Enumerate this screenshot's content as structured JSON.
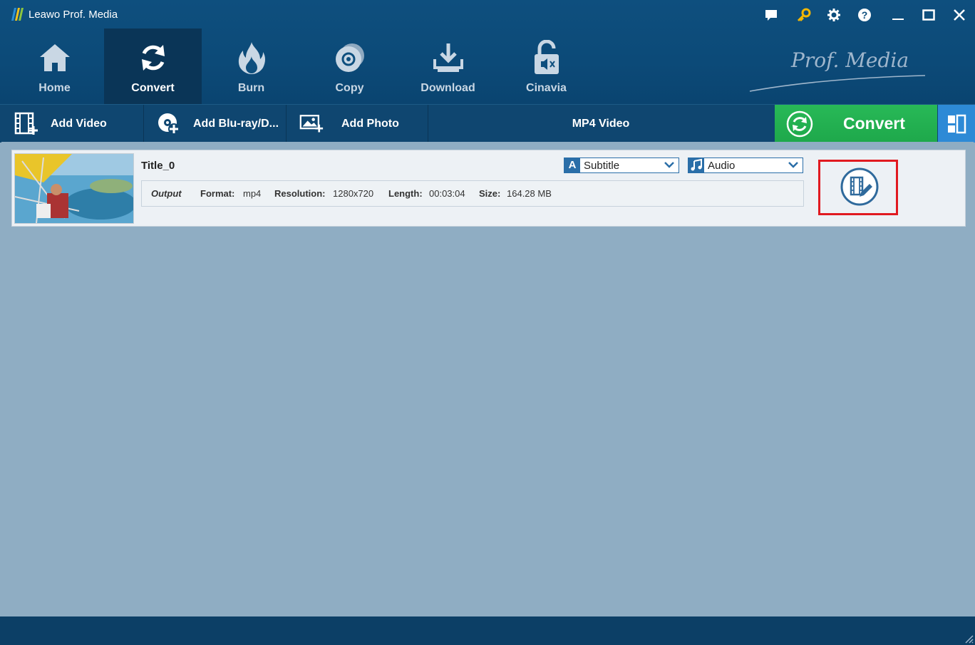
{
  "window": {
    "title": "Leawo Prof. Media"
  },
  "nav": {
    "items": [
      {
        "label": "Home",
        "icon": "home-icon"
      },
      {
        "label": "Convert",
        "icon": "convert-icon",
        "active": true
      },
      {
        "label": "Burn",
        "icon": "burn-icon"
      },
      {
        "label": "Copy",
        "icon": "copy-icon"
      },
      {
        "label": "Download",
        "icon": "download-icon"
      },
      {
        "label": "Cinavia",
        "icon": "cinavia-icon"
      }
    ]
  },
  "brand": {
    "text": "Prof. Media"
  },
  "toolbar": {
    "add_video": "Add Video",
    "add_bluray": "Add Blu-ray/D...",
    "add_photo": "Add Photo",
    "format": "MP4 Video",
    "convert": "Convert"
  },
  "file": {
    "title": "Title_0",
    "subtitle": "Subtitle",
    "audio": "Audio",
    "output_label": "Output",
    "format_key": "Format:",
    "format_val": "mp4",
    "resolution_key": "Resolution:",
    "resolution_val": "1280x720",
    "length_key": "Length:",
    "length_val": "00:03:04",
    "size_key": "Size:",
    "size_val": "164.28 MB"
  },
  "colors": {
    "header": "#0e4f7e",
    "convert_green": "#22ac4e",
    "content_bg": "#8fadc3",
    "highlight_red": "#e11a20"
  }
}
